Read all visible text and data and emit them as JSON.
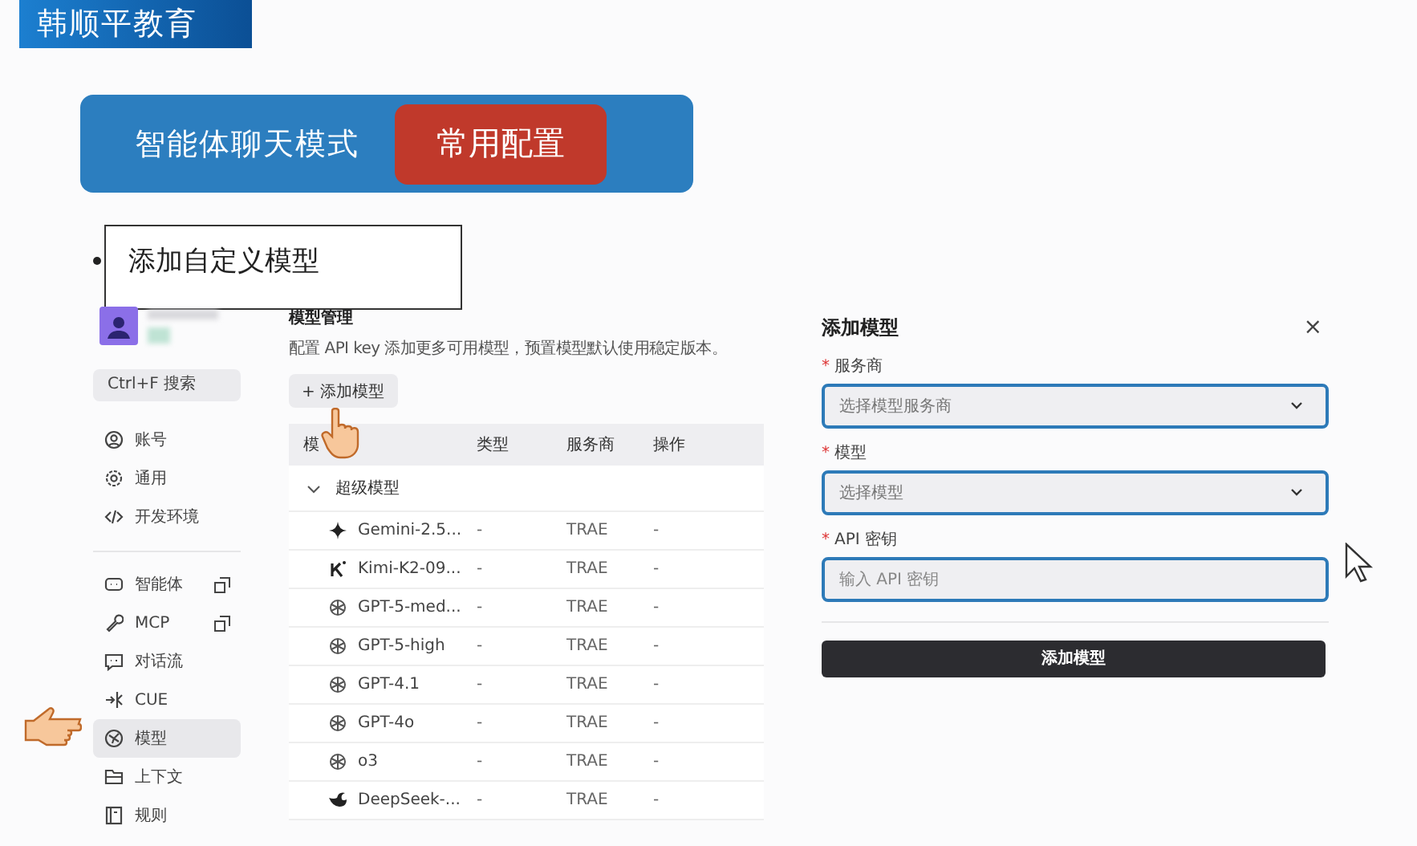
{
  "brand": "韩顺平教育",
  "banner": {
    "title": "智能体聊天模式",
    "tag": "常用配置"
  },
  "bullet": {
    "text": "添加自定义模型"
  },
  "sidebar": {
    "search_placeholder": "Ctrl+F 搜索",
    "groups": [
      [
        {
          "label": "账号",
          "external": false,
          "selected": false
        },
        {
          "label": "通用",
          "external": false,
          "selected": false
        },
        {
          "label": "开发环境",
          "external": false,
          "selected": false
        }
      ],
      [
        {
          "label": "智能体",
          "external": true,
          "selected": false
        },
        {
          "label": "MCP",
          "external": true,
          "selected": false
        },
        {
          "label": "对话流",
          "external": false,
          "selected": false
        },
        {
          "label": "CUE",
          "external": false,
          "selected": false
        },
        {
          "label": "模型",
          "external": false,
          "selected": true
        },
        {
          "label": "上下文",
          "external": false,
          "selected": false
        },
        {
          "label": "规则",
          "external": false,
          "selected": false
        }
      ]
    ]
  },
  "content": {
    "title": "模型管理",
    "description": "配置 API key 添加更多可用模型，预置模型默认使用稳定版本。",
    "add_button": "+ 添加模型",
    "columns": [
      "模",
      "类型",
      "服务商",
      "操作"
    ],
    "groups": [
      {
        "label": "超级模型",
        "expanded": true,
        "rows": [
          {
            "name": "Gemini-2.5...",
            "type": "-",
            "provider": "TRAE",
            "action": "-"
          },
          {
            "name": "Kimi-K2-09...",
            "type": "-",
            "provider": "TRAE",
            "action": "-"
          },
          {
            "name": "GPT-5-med...",
            "type": "-",
            "provider": "TRAE",
            "action": "-"
          },
          {
            "name": "GPT-5-high",
            "type": "-",
            "provider": "TRAE",
            "action": "-"
          },
          {
            "name": "GPT-4.1",
            "type": "-",
            "provider": "TRAE",
            "action": "-"
          },
          {
            "name": "GPT-4o",
            "type": "-",
            "provider": "TRAE",
            "action": "-"
          },
          {
            "name": "o3",
            "type": "-",
            "provider": "TRAE",
            "action": "-"
          },
          {
            "name": "DeepSeek-...",
            "type": "-",
            "provider": "TRAE",
            "action": "-"
          }
        ]
      }
    ]
  },
  "dialog": {
    "title": "添加模型",
    "close": "×",
    "fields": [
      {
        "kind": "select",
        "mark": "*",
        "label": "服务商",
        "placeholder": "选择模型服务商"
      },
      {
        "kind": "select",
        "mark": "*",
        "label": "模型",
        "placeholder": "选择模型"
      },
      {
        "kind": "input",
        "mark": "*",
        "label": "API 密钥",
        "placeholder": "输入 API 密钥"
      }
    ],
    "submit": "添加模型"
  }
}
